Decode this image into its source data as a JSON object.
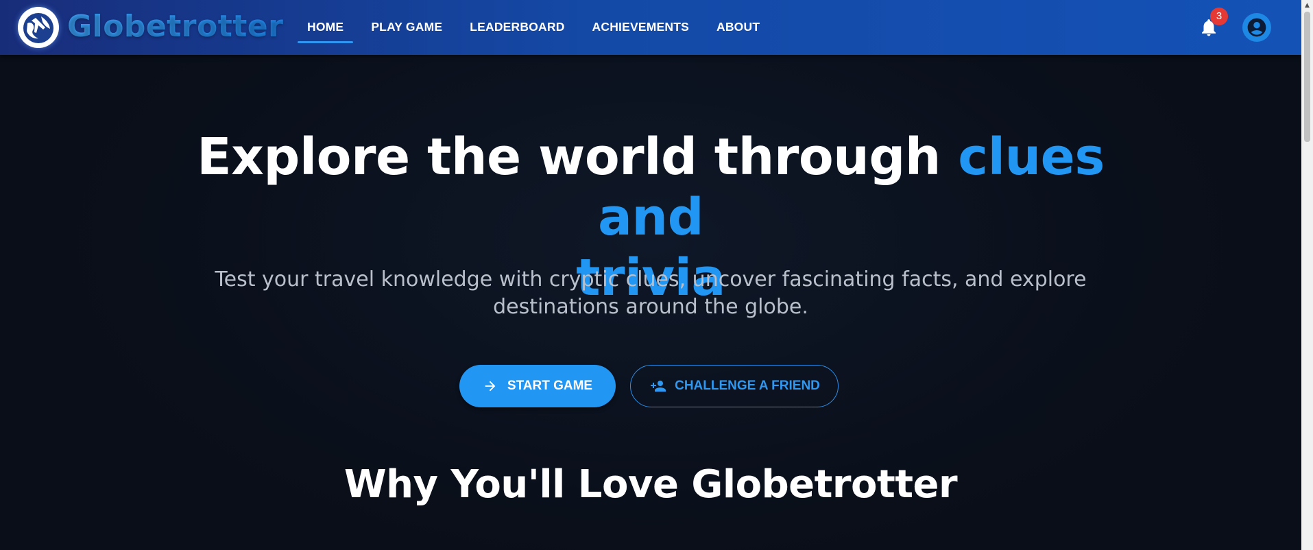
{
  "header": {
    "brand": "Globetrotter",
    "logo_icon": "globe-plane-icon",
    "nav": [
      {
        "label": "HOME",
        "active": true
      },
      {
        "label": "PLAY GAME",
        "active": false
      },
      {
        "label": "LEADERBOARD",
        "active": false
      },
      {
        "label": "ACHIEVEMENTS",
        "active": false
      },
      {
        "label": "ABOUT",
        "active": false
      }
    ],
    "notification_count": "3",
    "notification_icon": "bell-icon",
    "account_icon": "account-circle-icon"
  },
  "hero": {
    "title_plain": "Explore the world through",
    "title_accent_1": "clues and",
    "title_accent_2": "trivia",
    "subtitle_line1": "Test your travel knowledge with cryptic clues, uncover fascinating facts, and explore",
    "subtitle_line2": "destinations around the globe.",
    "start_button": "START GAME",
    "start_icon": "arrow-right-icon",
    "challenge_button": "CHALLENGE A FRIEND",
    "challenge_icon": "person-add-icon"
  },
  "features": {
    "title": "Why You'll Love Globetrotter"
  },
  "colors": {
    "accent": "#2196f3",
    "background": "#0b111d",
    "header_start": "#182d7a",
    "header_end": "#1452b6",
    "badge": "#e53935"
  }
}
